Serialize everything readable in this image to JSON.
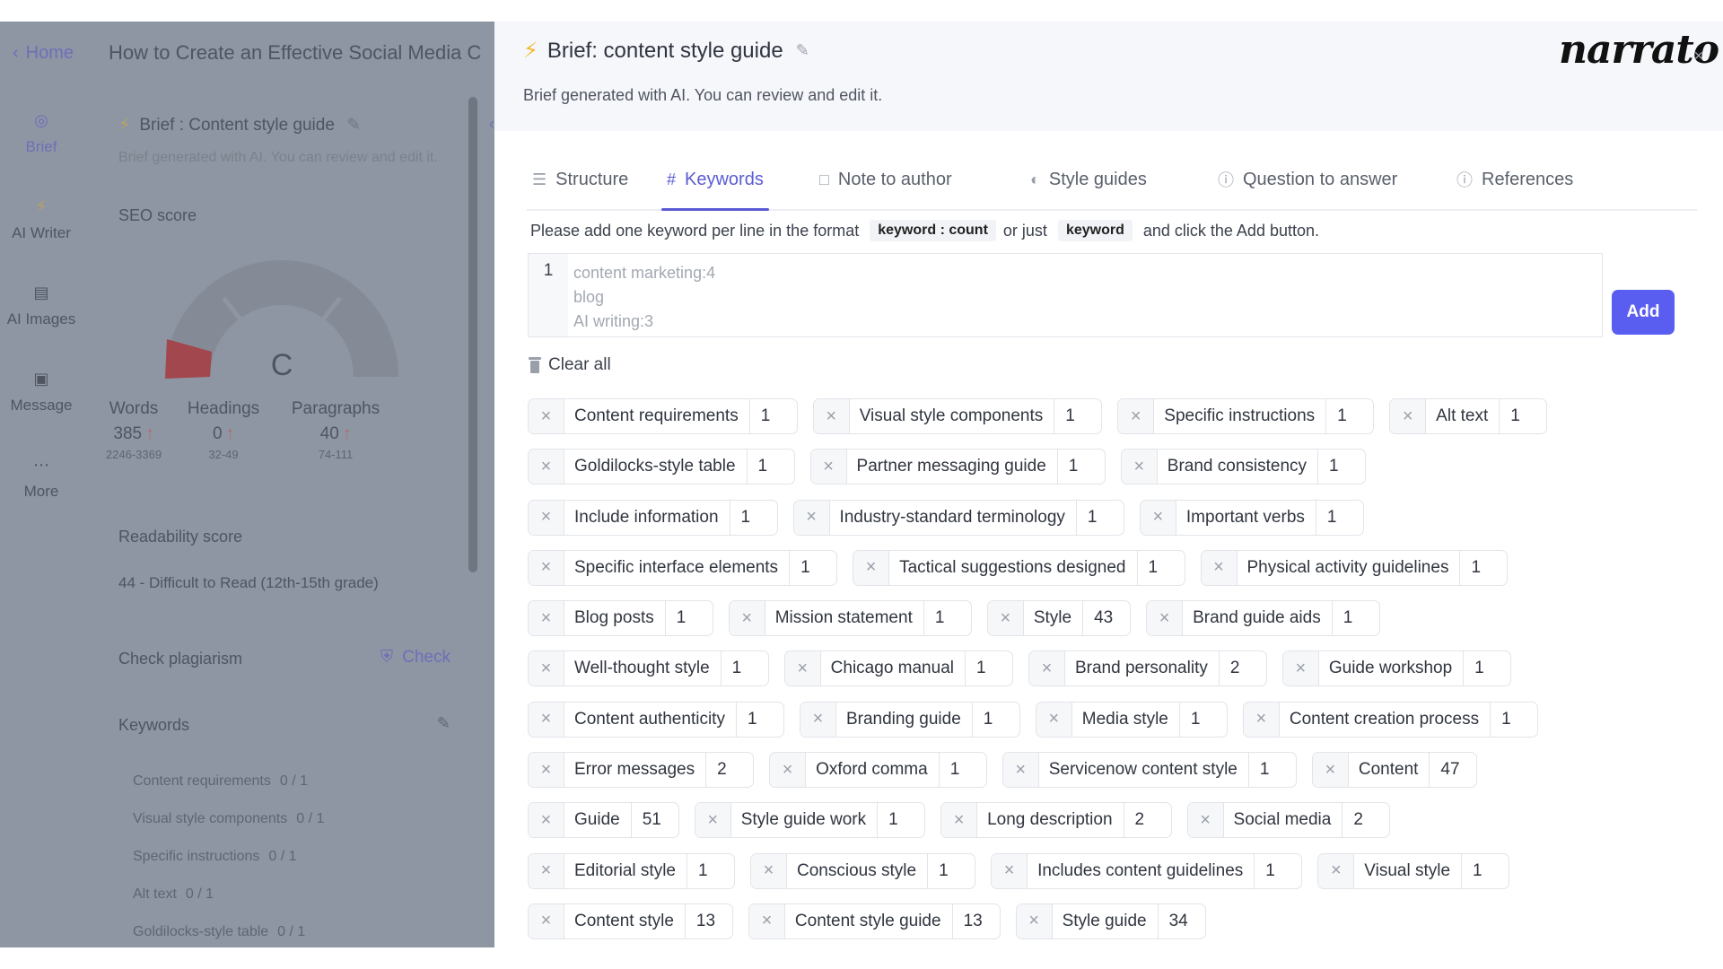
{
  "background_app": {
    "home_label": "Home",
    "document_title": "How to Create an Effective Social Media C",
    "rail": [
      {
        "label": "Brief",
        "icon": "target-icon",
        "active": true
      },
      {
        "label": "AI Writer",
        "icon": "bolt-icon",
        "active": false
      },
      {
        "label": "AI Images",
        "icon": "image-icon",
        "active": false
      },
      {
        "label": "Message",
        "icon": "message-icon",
        "active": false
      },
      {
        "label": "More",
        "icon": "more-icon",
        "active": false
      }
    ],
    "brief_title": "Brief : Content style guide",
    "brief_subtitle": "Brief generated with AI. You can review and edit it.",
    "seo_score_label": "SEO score",
    "seo_grade": "C",
    "stats": [
      {
        "label": "Words",
        "value": "385",
        "range": "2246-3369"
      },
      {
        "label": "Headings",
        "value": "0",
        "range": "32-49"
      },
      {
        "label": "Paragraphs",
        "value": "40",
        "range": "74-111"
      }
    ],
    "readability_label": "Readability score",
    "readability_value": "44 - Difficult to Read (12th-15th grade)",
    "plagiarism_label": "Check plagiarism",
    "plagiarism_button": "Check",
    "keywords_label": "Keywords",
    "keyword_progress": [
      {
        "keyword": "Content requirements",
        "count": "0 / 1"
      },
      {
        "keyword": "Visual style components",
        "count": "0 / 1"
      },
      {
        "keyword": "Specific instructions",
        "count": "0 / 1"
      },
      {
        "keyword": "Alt text",
        "count": "0 / 1"
      },
      {
        "keyword": "Goldilocks-style table",
        "count": "0 / 1"
      }
    ]
  },
  "drawer": {
    "title": "Brief: content style guide",
    "subtitle": "Brief generated with AI. You can review and edit it.",
    "logo": "narrato",
    "tabs": [
      {
        "label": "Structure",
        "icon": "list-icon",
        "active": false
      },
      {
        "label": "Keywords",
        "icon": "hash-icon",
        "active": true
      },
      {
        "label": "Note to author",
        "icon": "note-icon",
        "active": false
      },
      {
        "label": "Style guides",
        "icon": "palette-icon",
        "active": false
      },
      {
        "label": "Question to answer",
        "icon": "question-icon",
        "active": false
      },
      {
        "label": "References",
        "icon": "info-icon",
        "active": false
      }
    ],
    "instructions": {
      "part1": "Please add one keyword per line in the format",
      "code1": "keyword : count",
      "part2": "or just",
      "code2": "keyword",
      "part3": "and click the Add button."
    },
    "editor": {
      "line_number": "1",
      "placeholder_lines": [
        "content marketing:4",
        "blog",
        "AI writing:3"
      ]
    },
    "add_button": "Add",
    "clear_all": "Clear all",
    "keyword_rows": [
      [
        [
          "Content requirements",
          "1"
        ],
        [
          "Visual style components",
          "1"
        ],
        [
          "Specific instructions",
          "1"
        ],
        [
          "Alt text",
          "1"
        ]
      ],
      [
        [
          "Goldilocks-style table",
          "1"
        ],
        [
          "Partner messaging guide",
          "1"
        ],
        [
          "Brand consistency",
          "1"
        ]
      ],
      [
        [
          "Include information",
          "1"
        ],
        [
          "Industry-standard terminology",
          "1"
        ],
        [
          "Important verbs",
          "1"
        ]
      ],
      [
        [
          "Specific interface elements",
          "1"
        ],
        [
          "Tactical suggestions designed",
          "1"
        ],
        [
          "Physical activity guidelines",
          "1"
        ]
      ],
      [
        [
          "Blog posts",
          "1"
        ],
        [
          "Mission statement",
          "1"
        ],
        [
          "Style",
          "43"
        ],
        [
          "Brand guide aids",
          "1"
        ]
      ],
      [
        [
          "Well-thought style",
          "1"
        ],
        [
          "Chicago manual",
          "1"
        ],
        [
          "Brand personality",
          "2"
        ],
        [
          "Guide workshop",
          "1"
        ]
      ],
      [
        [
          "Content authenticity",
          "1"
        ],
        [
          "Branding guide",
          "1"
        ],
        [
          "Media style",
          "1"
        ],
        [
          "Content creation process",
          "1"
        ]
      ],
      [
        [
          "Error messages",
          "2"
        ],
        [
          "Oxford comma",
          "1"
        ],
        [
          "Servicenow content style",
          "1"
        ],
        [
          "Content",
          "47"
        ]
      ],
      [
        [
          "Guide",
          "51"
        ],
        [
          "Style guide work",
          "1"
        ],
        [
          "Long description",
          "2"
        ],
        [
          "Social media",
          "2"
        ]
      ],
      [
        [
          "Editorial style",
          "1"
        ],
        [
          "Conscious style",
          "1"
        ],
        [
          "Includes content guidelines",
          "1"
        ],
        [
          "Visual style",
          "1"
        ]
      ],
      [
        [
          "Content style",
          "13"
        ],
        [
          "Content style guide",
          "13"
        ],
        [
          "Style guide",
          "34"
        ]
      ]
    ],
    "colors": {
      "accent": "#5a5ef0",
      "bolt": "#f4b731"
    }
  }
}
